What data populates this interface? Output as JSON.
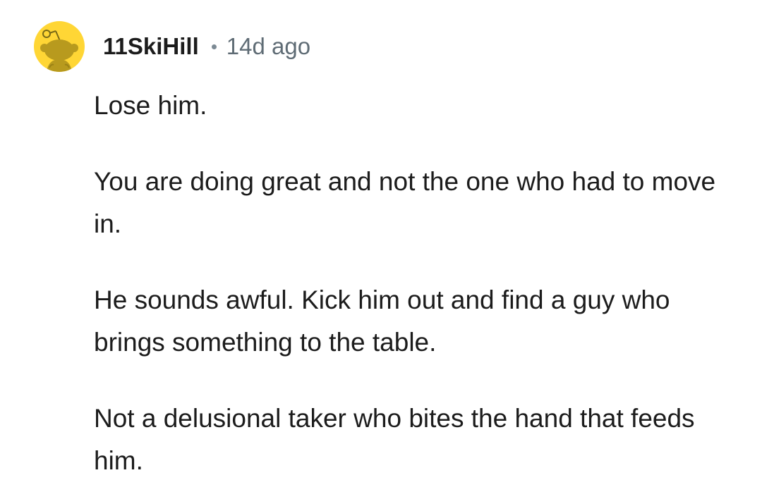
{
  "comment": {
    "author": "11SkiHill",
    "timestamp": "14d ago",
    "avatar_icon": "snoo-avatar-icon",
    "avatar_color": "#ffd635",
    "paragraphs": [
      "Lose him.",
      "You are doing great and not the one who had to move in.",
      "He sounds awful. Kick him out and find a guy who brings something to the table.",
      "Not a delusional taker who bites the hand that feeds him."
    ]
  }
}
